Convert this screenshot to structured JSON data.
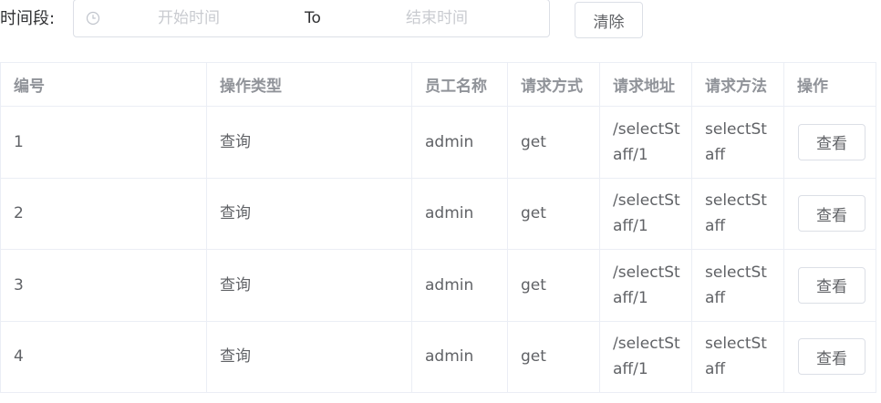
{
  "filter": {
    "label": "时间段:",
    "icon": "clock-icon",
    "start_placeholder": "开始时间",
    "separator": "To",
    "end_placeholder": "结束时间",
    "clear_label": "清除"
  },
  "table": {
    "headers": [
      "编号",
      "操作类型",
      "员工名称",
      "请求方式",
      "请求地址",
      "请求方法",
      "操作"
    ],
    "rows": [
      {
        "id": "1",
        "op_type": "查询",
        "staff": "admin",
        "method": "get",
        "url": "/selectStaff/1",
        "func": "selectStaff",
        "action": "查看"
      },
      {
        "id": "2",
        "op_type": "查询",
        "staff": "admin",
        "method": "get",
        "url": "/selectStaff/1",
        "func": "selectStaff",
        "action": "查看"
      },
      {
        "id": "3",
        "op_type": "查询",
        "staff": "admin",
        "method": "get",
        "url": "/selectStaff/1",
        "func": "selectStaff",
        "action": "查看"
      },
      {
        "id": "4",
        "op_type": "查询",
        "staff": "admin",
        "method": "get",
        "url": "/selectStaff/1",
        "func": "selectStaff",
        "action": "查看"
      }
    ]
  },
  "colors": {
    "border": "#dcdfe6",
    "table_border": "#ebeef5",
    "header_text": "#909399",
    "body_text": "#606266",
    "placeholder": "#c0c4cc"
  }
}
